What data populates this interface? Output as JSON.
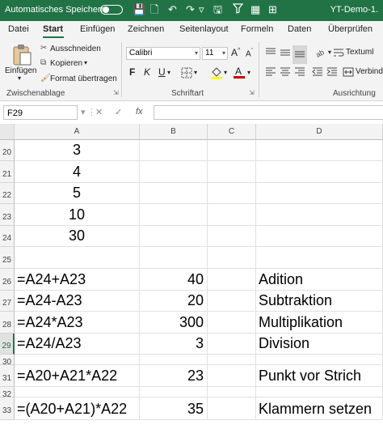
{
  "title_bar": {
    "autosave_label": "Automatisches Speichern",
    "doc_title": "YT-Demo-1.",
    "quick_access": [
      "💾",
      "🗋",
      "↶",
      "↷",
      "▿",
      "🖫",
      "⚲",
      "▦",
      "⊞"
    ]
  },
  "ribbon_tabs": [
    "Datei",
    "Start",
    "Einfügen",
    "Zeichnen",
    "Seitenlayout",
    "Formeln",
    "Daten",
    "Überprüfen"
  ],
  "ribbon": {
    "paste_label": "Einfügen",
    "cut_label": "Ausschneiden",
    "copy_label": "Kopieren",
    "format_painter_label": "Format übertragen",
    "clipboard_group": "Zwischenablage",
    "font_name": "Calibri",
    "font_size": "11",
    "grow_font": "A",
    "shrink_font": "A",
    "bold": "F",
    "italic": "K",
    "underline": "U",
    "font_group": "Schriftart",
    "wrap_text_label": "Textuml",
    "merge_label": "Verbind",
    "alignment_group": "Ausrichtung",
    "font_color_hex": "#c00000",
    "fill_color_hex": "#ffff00"
  },
  "formula_bar": {
    "name_box": "F29",
    "cancel": "✕",
    "enter": "✓",
    "fx": "fx",
    "formula": ""
  },
  "columns": [
    "A",
    "B",
    "C",
    "D"
  ],
  "rows": [
    {
      "num": "20",
      "a": "3",
      "b": "",
      "d": ""
    },
    {
      "num": "21",
      "a": "4",
      "b": "",
      "d": ""
    },
    {
      "num": "22",
      "a": "5",
      "b": "",
      "d": ""
    },
    {
      "num": "23",
      "a": "10",
      "b": "",
      "d": ""
    },
    {
      "num": "24",
      "a": "30",
      "b": "",
      "d": ""
    },
    {
      "num": "25",
      "a": "",
      "b": "",
      "d": ""
    },
    {
      "num": "26",
      "a": "=A24+A23",
      "b": "40",
      "d": "Adition"
    },
    {
      "num": "27",
      "a": "=A24-A23",
      "b": "20",
      "d": "Subtraktion"
    },
    {
      "num": "28",
      "a": "=A24*A23",
      "b": "300",
      "d": "Multiplikation"
    },
    {
      "num": "29",
      "a": "=A24/A23",
      "b": "3",
      "d": "Division"
    },
    {
      "num": "30",
      "a": "",
      "b": "",
      "d": ""
    },
    {
      "num": "31",
      "a": "=A20+A21*A22",
      "b": "23",
      "d": "Punkt vor Strich"
    },
    {
      "num": "32",
      "a": "",
      "b": "",
      "d": ""
    },
    {
      "num": "33",
      "a": "=(A20+A21)*A22",
      "b": "35",
      "d": "Klammern setzen"
    }
  ],
  "selected_row": "29"
}
